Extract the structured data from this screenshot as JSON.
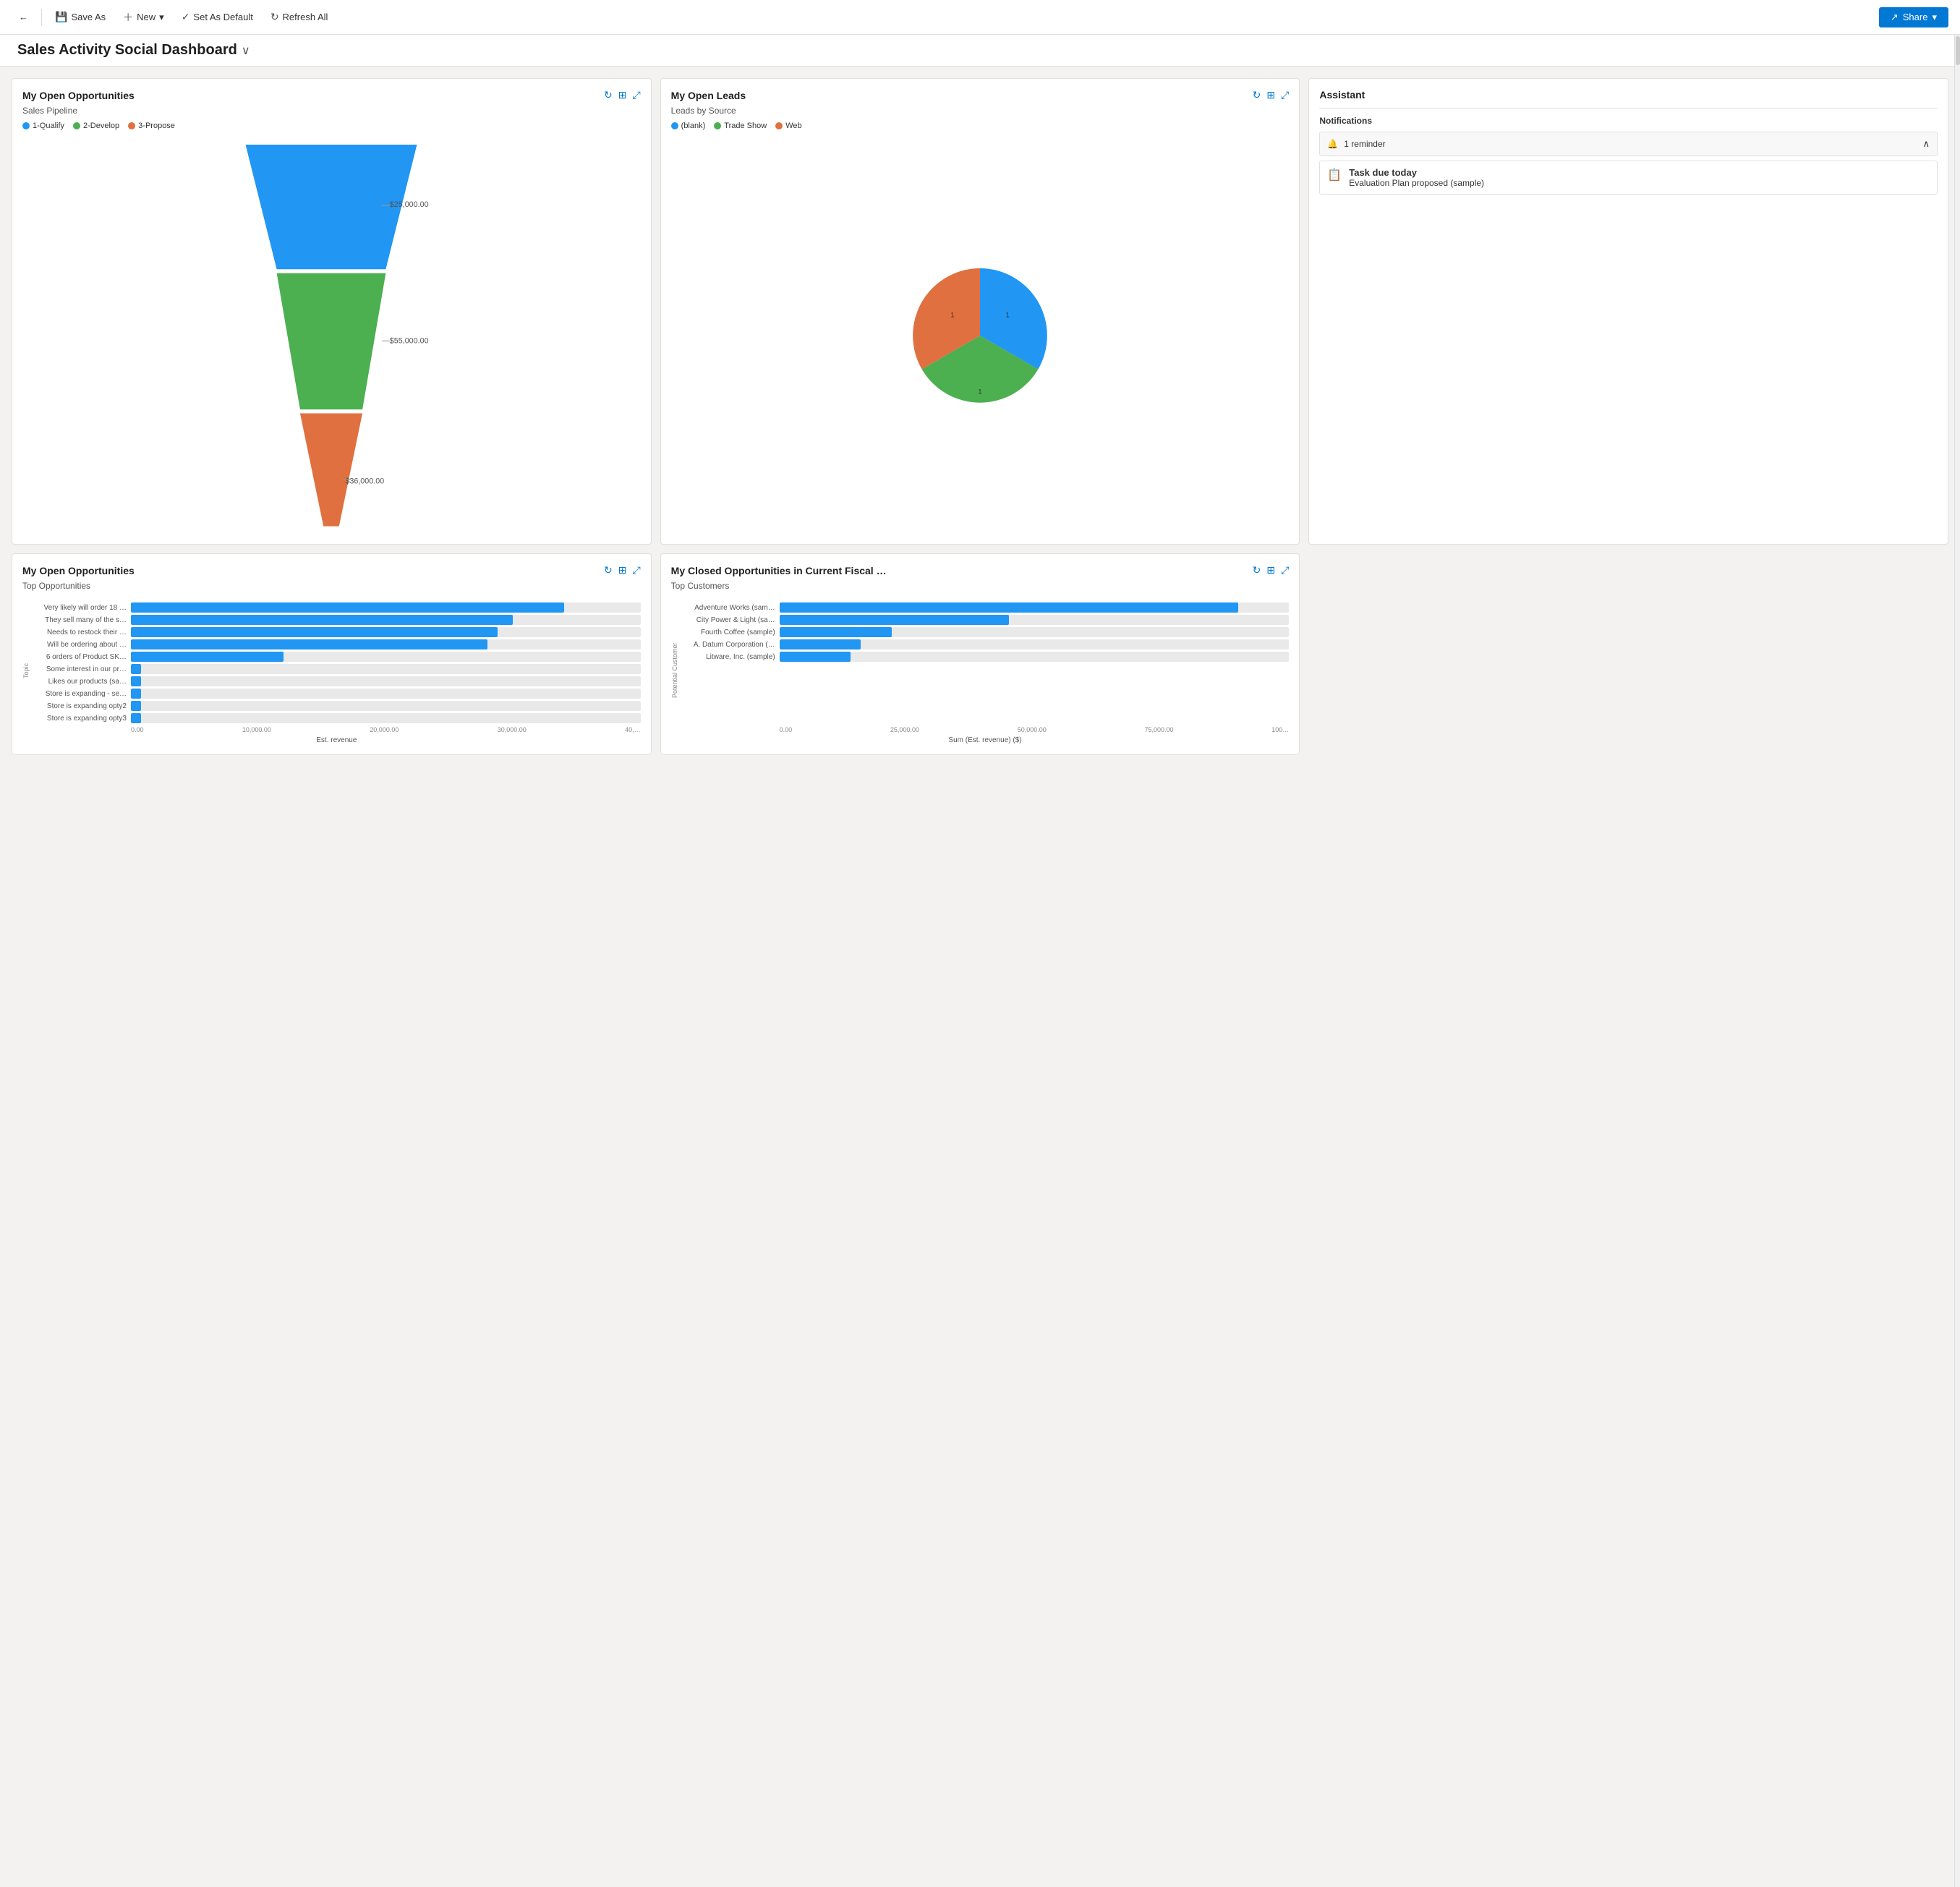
{
  "toolbar": {
    "back_icon": "←",
    "save_as_label": "Save As",
    "new_label": "New",
    "set_default_label": "Set As Default",
    "refresh_label": "Refresh All",
    "share_label": "Share"
  },
  "page": {
    "title": "Sales Activity Social Dashboard",
    "chevron": "∨"
  },
  "cards": {
    "my_open_opportunities": {
      "title": "My Open Opportunities",
      "subtitle": "Sales Pipeline",
      "legend": [
        {
          "label": "1-Qualify",
          "color": "#2196F3"
        },
        {
          "label": "2-Develop",
          "color": "#4caf50"
        },
        {
          "label": "3-Propose",
          "color": "#e07040"
        }
      ],
      "funnel": [
        {
          "stage": "1-Qualify",
          "value": "$25,000.00",
          "color": "#2196F3",
          "pct": 100
        },
        {
          "stage": "2-Develop",
          "value": "$55,000.00",
          "color": "#4caf50",
          "pct": 75
        },
        {
          "stage": "3-Propose",
          "value": "$36,000.00",
          "color": "#e07040",
          "pct": 40
        }
      ]
    },
    "my_open_leads": {
      "title": "My Open Leads",
      "subtitle": "Leads by Source",
      "legend": [
        {
          "label": "(blank)",
          "color": "#2196F3"
        },
        {
          "label": "Trade Show",
          "color": "#4caf50"
        },
        {
          "label": "Web",
          "color": "#e07040"
        }
      ],
      "pie": [
        {
          "label": "(blank)",
          "value": 1,
          "color": "#2196F3",
          "startAngle": 0,
          "endAngle": 120
        },
        {
          "label": "Trade Show",
          "value": 1,
          "color": "#4caf50",
          "startAngle": 120,
          "endAngle": 240
        },
        {
          "label": "Web",
          "value": 1,
          "color": "#e07040",
          "startAngle": 240,
          "endAngle": 360
        }
      ]
    },
    "assistant": {
      "title": "Assistant",
      "notifications_title": "Notifications",
      "reminder_label": "1 reminder",
      "task": {
        "title": "Task due today",
        "description": "Evaluation Plan proposed (sample)"
      }
    },
    "my_open_opps_bar": {
      "title": "My Open Opportunities",
      "subtitle": "Top Opportunities",
      "x_axis_label": "Est. revenue",
      "x_ticks": [
        "0.00",
        "10,000.00",
        "20,000.00",
        "30,000.00",
        "40,…"
      ],
      "bars": [
        {
          "label": "Very likely will order 18 …",
          "pct": 85
        },
        {
          "label": "They sell many of the s…",
          "pct": 75
        },
        {
          "label": "Needs to restock their …",
          "pct": 72
        },
        {
          "label": "Will be ordering about …",
          "pct": 70
        },
        {
          "label": "6 orders of Product SK…",
          "pct": 30
        },
        {
          "label": "Some interest in our pr…",
          "pct": 0
        },
        {
          "label": "Likes our products (sa…",
          "pct": 0
        },
        {
          "label": "Store is expanding - se…",
          "pct": 0
        },
        {
          "label": "Store is expanding opty2",
          "pct": 0
        },
        {
          "label": "Store is expanding opty3",
          "pct": 0
        }
      ]
    },
    "closed_opps": {
      "title": "My Closed Opportunities in Current Fiscal …",
      "subtitle": "Top Customers",
      "x_axis_label": "Sum (Est. revenue) ($)",
      "x_ticks": [
        "0.00",
        "25,000.00",
        "50,000.00",
        "75,000.00",
        "100…"
      ],
      "y_axis_label": "Potential Customer",
      "bars": [
        {
          "label": "Adventure Works (sam…",
          "pct": 90
        },
        {
          "label": "City Power & Light (sa…",
          "pct": 45
        },
        {
          "label": "Fourth Coffee (sample)",
          "pct": 22
        },
        {
          "label": "A. Datum Corporation (…",
          "pct": 16
        },
        {
          "label": "Litware, Inc. (sample)",
          "pct": 14
        }
      ]
    }
  }
}
